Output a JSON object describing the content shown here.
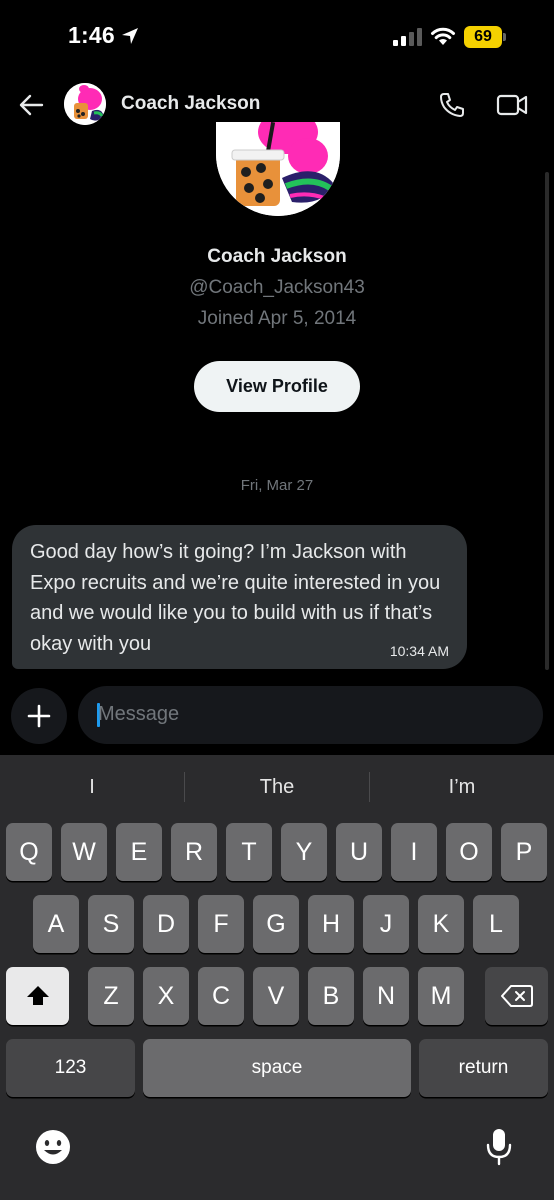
{
  "status_bar": {
    "time": "1:46",
    "battery": "69",
    "icons": [
      "location-arrow-icon",
      "signal-icon",
      "wifi-icon",
      "battery-icon"
    ],
    "battery_color": "#f5d100"
  },
  "header": {
    "title": "Coach Jackson",
    "icons": [
      "back-arrow-icon",
      "phone-icon",
      "video-icon"
    ]
  },
  "profile": {
    "name": "Coach Jackson",
    "handle": "@Coach_Jackson43",
    "joined": "Joined Apr 5, 2014",
    "view_profile_label": "View Profile"
  },
  "conversation": {
    "date_separator": "Fri, Mar 27",
    "messages": [
      {
        "text": "Good day how’s it going? I’m  Jackson with Expo recruits and we’re quite interested in you and we would like you to build with us if that’s okay with you",
        "time": "10:34 AM"
      }
    ]
  },
  "composer": {
    "placeholder": "Message",
    "add_icon": "plus-icon"
  },
  "keyboard": {
    "suggestions": [
      "I",
      "The",
      "I’m"
    ],
    "row1": [
      "Q",
      "W",
      "E",
      "R",
      "T",
      "Y",
      "U",
      "I",
      "O",
      "P"
    ],
    "row2": [
      "A",
      "S",
      "D",
      "F",
      "G",
      "H",
      "J",
      "K",
      "L"
    ],
    "row3": [
      "Z",
      "X",
      "C",
      "V",
      "B",
      "N",
      "M"
    ],
    "numbers_label": "123",
    "space_label": "space",
    "return_label": "return",
    "icons": [
      "shift-icon",
      "delete-icon",
      "emoji-icon",
      "microphone-icon"
    ]
  },
  "colors": {
    "background": "#000000",
    "bubble": "#2f3336",
    "accent": "#1d9bf0",
    "secondary_text": "#71767b"
  }
}
